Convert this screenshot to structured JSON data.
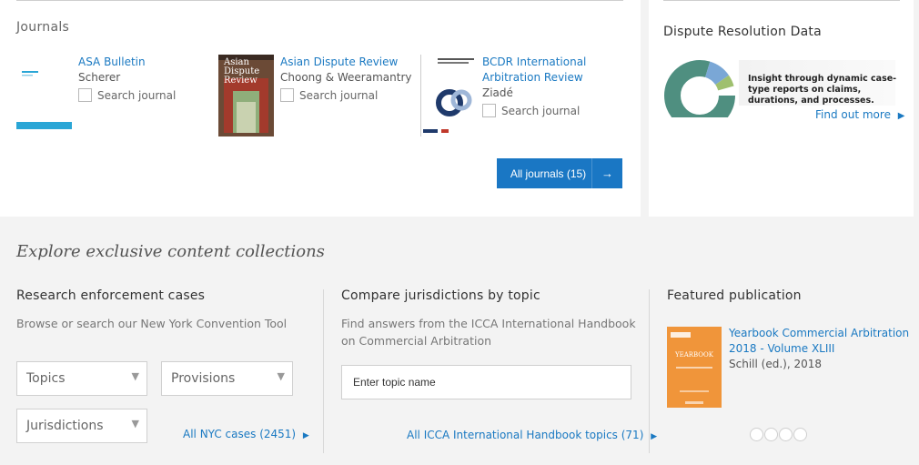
{
  "journals": {
    "heading": "Journals",
    "items": [
      {
        "title_lines": [
          "ASA Bulletin"
        ],
        "author": "Scherer",
        "search_label": "Search journal"
      },
      {
        "title_lines": [
          "Asian Dispute Review"
        ],
        "author": "Choong & Weeramantry",
        "search_label": "Search journal",
        "cover_text": [
          "Asian",
          "Dispute",
          "Review"
        ]
      },
      {
        "title_lines": [
          "BCDR International",
          "Arbitration Review"
        ],
        "author": "Ziadé",
        "search_label": "Search journal"
      }
    ],
    "all_button": "All journals (15)",
    "all_button_arrow": "→"
  },
  "dispute_data": {
    "heading": "Dispute Resolution Data",
    "text": "Insight through dynamic case-type reports on claims, durations, and processes.",
    "link": "Find out more",
    "link_arrow": "▶"
  },
  "explore": {
    "heading": "Explore exclusive content collections",
    "research": {
      "title": "Research enforcement cases",
      "desc": "Browse or search our New York Convention Tool",
      "selects": [
        "Topics",
        "Provisions",
        "Jurisdictions"
      ],
      "caret": "▼",
      "link": "All NYC cases (2451)",
      "link_arrow": "▶"
    },
    "compare": {
      "title": "Compare jurisdictions by topic",
      "desc": "Find answers from the ICCA International Handbook on Commercial Arbitration",
      "input_placeholder": "Enter topic name",
      "link": "All ICCA International Handbook topics (71)",
      "link_arrow": "▶"
    },
    "featured": {
      "title": "Featured publication",
      "pub_title_lines": [
        "Yearbook Commercial Arbitration",
        "2018 - Volume XLIII"
      ],
      "pub_meta": "Schill (ed.), 2018",
      "cover_text": "YEARBOOK"
    }
  },
  "colors": {
    "accent_blue": "#1a77c4",
    "link_blue": "#1a79c2",
    "yearbook_orange": "#f0953a",
    "adr_red": "#c0392b",
    "donut_teal": "#4f8f80"
  }
}
